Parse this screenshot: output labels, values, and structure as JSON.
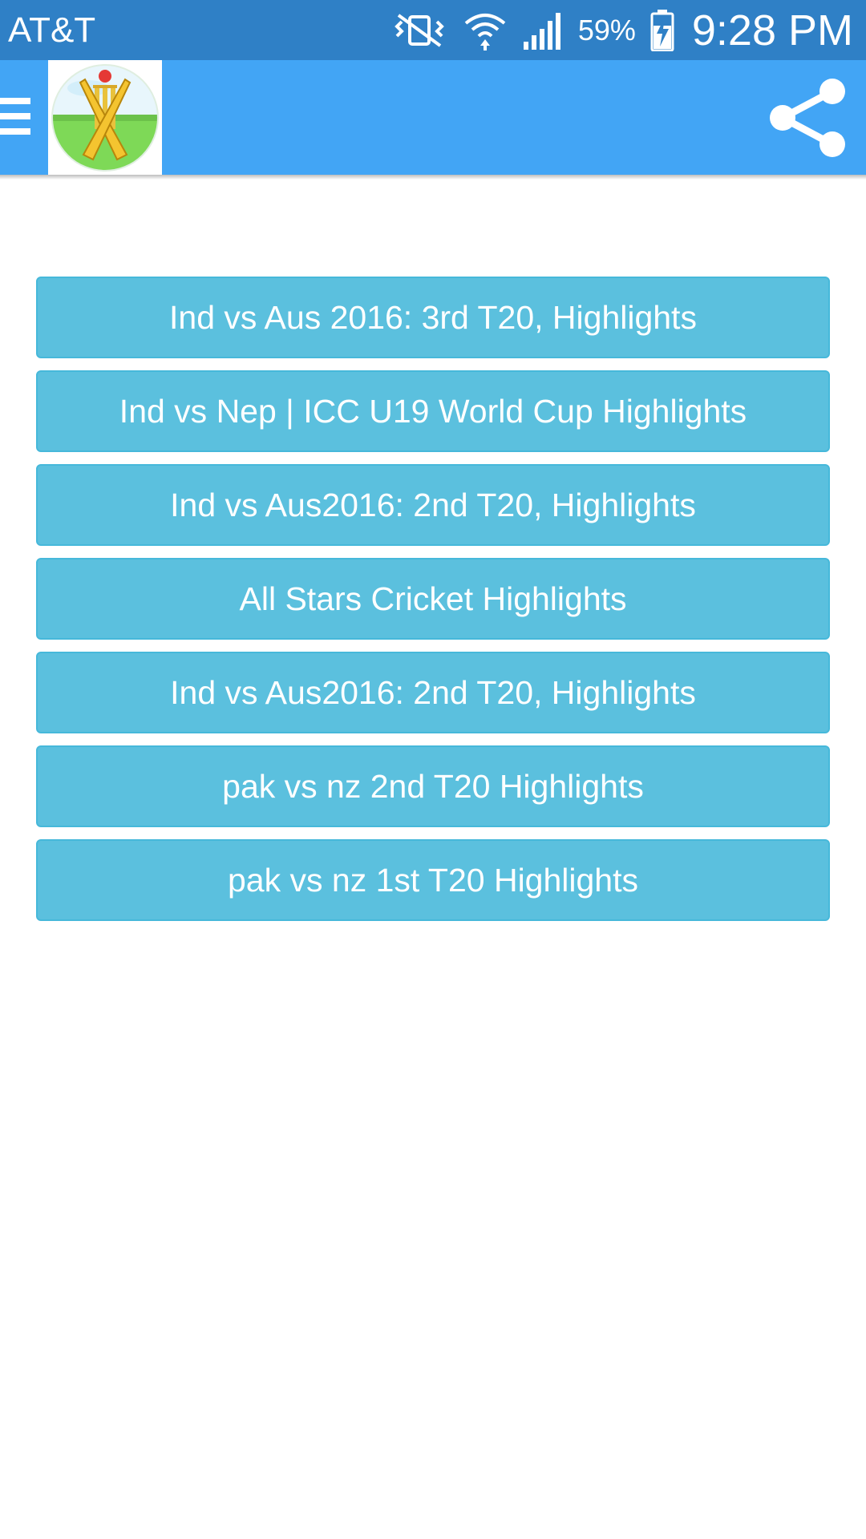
{
  "status_bar": {
    "carrier": "AT&T",
    "battery_percent": "59%",
    "time": "9:28 PM",
    "icons": [
      "vibrate-icon",
      "wifi-icon",
      "signal-icon",
      "battery-charging-icon"
    ]
  },
  "app_bar": {
    "menu_icon": "menu-icon",
    "logo": "cricket-logo",
    "share_icon": "share-icon",
    "background_color": "#42a5f5"
  },
  "highlights": [
    {
      "label": "Ind vs Aus 2016: 3rd T20, Highlights"
    },
    {
      "label": "Ind vs Nep | ICC U19 World Cup Highlights"
    },
    {
      "label": "Ind vs Aus2016: 2nd T20, Highlights"
    },
    {
      "label": "All Stars Cricket Highlights"
    },
    {
      "label": "Ind vs Aus2016: 2nd T20, Highlights"
    },
    {
      "label": "pak vs nz 2nd T20 Highlights"
    },
    {
      "label": "pak vs nz 1st T20 Highlights"
    }
  ],
  "colors": {
    "status_bar": "#2f80c6",
    "button": "#5bc0de",
    "button_border": "#46b8da"
  }
}
